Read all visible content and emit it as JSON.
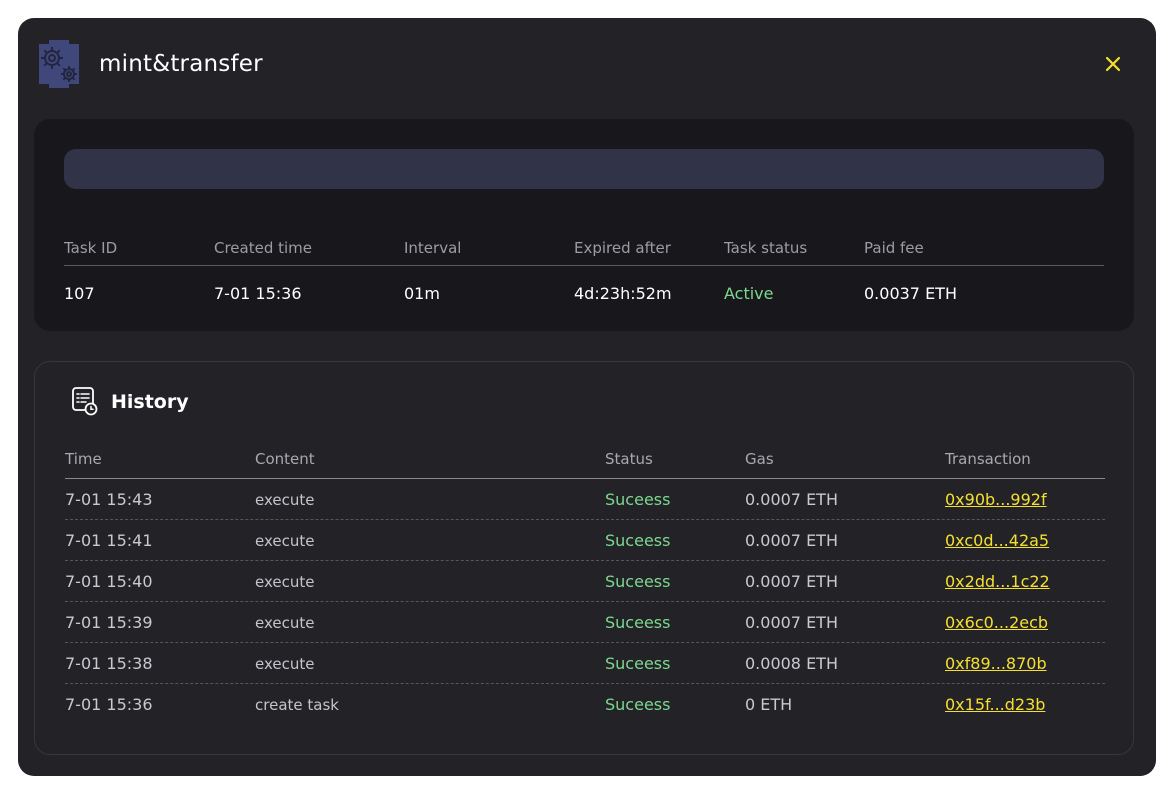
{
  "modal": {
    "title": "mint&transfer",
    "app_icon": "gears-icon",
    "close_icon": "close-icon",
    "accent_color": "#f5e030"
  },
  "task_info": {
    "progress": 0,
    "columns": [
      "Task ID",
      "Created time",
      "Interval",
      "Expired after",
      "Task status",
      "Paid fee"
    ],
    "values": [
      "107",
      "7-01 15:36",
      "01m",
      "4d:23h:52m",
      "Active",
      "0.0037 ETH"
    ]
  },
  "history": {
    "title": "History",
    "icon": "history-log-icon",
    "columns": [
      "Time",
      "Content",
      "Status",
      "Gas",
      "Transaction"
    ],
    "rows": [
      {
        "time": "7-01 15:43",
        "content": "execute",
        "status": "Suceess",
        "gas": "0.0007 ETH",
        "tx": "0x90b...992f"
      },
      {
        "time": "7-01 15:41",
        "content": "execute",
        "status": "Suceess",
        "gas": "0.0007 ETH",
        "tx": "0xc0d...42a5"
      },
      {
        "time": "7-01 15:40",
        "content": "execute",
        "status": "Suceess",
        "gas": "0.0007 ETH",
        "tx": "0x2dd...1c22"
      },
      {
        "time": "7-01 15:39",
        "content": "execute",
        "status": "Suceess",
        "gas": "0.0007 ETH",
        "tx": "0x6c0...2ecb"
      },
      {
        "time": "7-01 15:38",
        "content": "execute",
        "status": "Suceess",
        "gas": "0.0008 ETH",
        "tx": "0xf89...870b"
      },
      {
        "time": "7-01 15:36",
        "content": "create task",
        "status": "Suceess",
        "gas": "0 ETH",
        "tx": "0x15f...d23b"
      }
    ]
  },
  "colors": {
    "success": "#7dd88f",
    "link": "#f5e030",
    "panel": "#18181c",
    "background": "#222227"
  }
}
